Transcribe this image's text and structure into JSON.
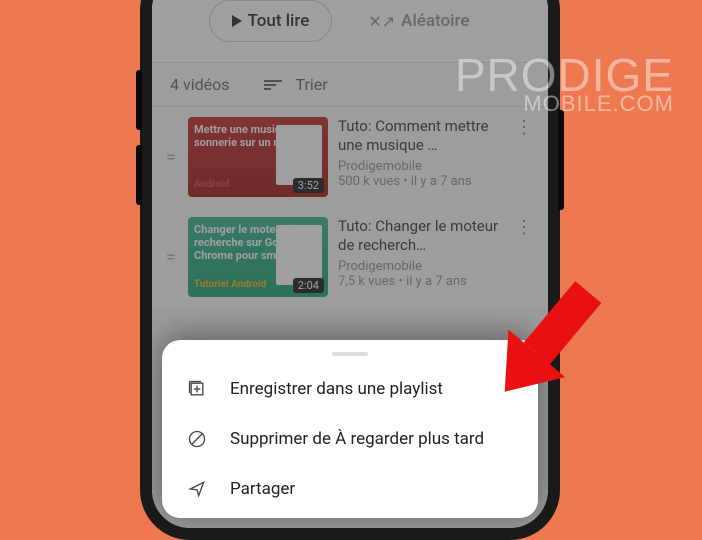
{
  "controls": {
    "play_all": "Tout lire",
    "shuffle": "Aléatoire"
  },
  "listbar": {
    "count": "4 vidéos",
    "sort": "Trier"
  },
  "videos": [
    {
      "thumb_lines": "Mettre une musique en sonnerie sur un mobile",
      "thumb_tag": "Android",
      "duration": "3:52",
      "title": "Tuto: Comment mettre une musique …",
      "channel": "Prodigemobile",
      "stats": "500 k vues • il y a 7 ans"
    },
    {
      "thumb_lines": "Changer le moteur de recherche sur Google Chrome pour smartphone",
      "thumb_tag": "Tutoriel Android",
      "duration": "2:04",
      "title": "Tuto: Changer le moteur de recherch…",
      "channel": "Prodigemobile",
      "stats": "7,5 k vues • il y a 7 ans"
    }
  ],
  "sheet": {
    "save": "Enregistrer dans une playlist",
    "remove": "Supprimer de À regarder plus tard",
    "share": "Partager"
  },
  "watermark": {
    "line1": "PRODIGE",
    "line2": "MOBILE.COM"
  }
}
